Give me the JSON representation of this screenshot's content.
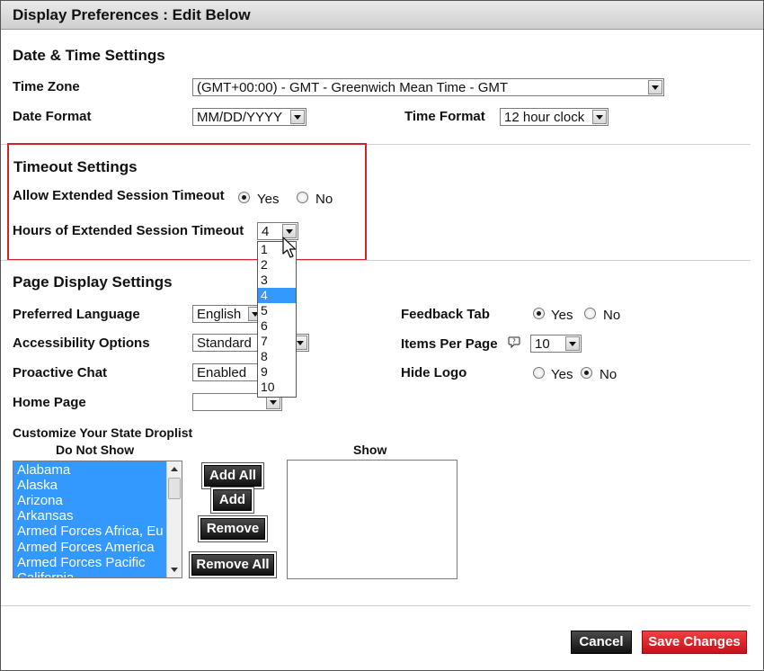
{
  "window": {
    "title": "Display Preferences : Edit Below"
  },
  "datetime": {
    "section_title": "Date & Time Settings",
    "timezone_label": "Time Zone",
    "timezone_value": "(GMT+00:00) - GMT - Greenwich Mean Time - GMT",
    "date_format_label": "Date Format",
    "date_format_value": "MM/DD/YYYY",
    "time_format_label": "Time Format",
    "time_format_value": "12 hour clock"
  },
  "timeout": {
    "section_title": "Timeout Settings",
    "allow_label": "Allow Extended Session Timeout",
    "yes": "Yes",
    "no": "No",
    "allow_selected": "Yes",
    "hours_label": "Hours of Extended Session Timeout",
    "hours_value": "4",
    "hours_options": [
      "1",
      "2",
      "3",
      "4",
      "5",
      "6",
      "7",
      "8",
      "9",
      "10"
    ],
    "highlight_color": "#d2232a"
  },
  "page_display": {
    "section_title": "Page Display Settings",
    "language_label": "Preferred Language",
    "language_value": "English",
    "accessibility_label": "Accessibility Options",
    "accessibility_value": "Standard",
    "proactive_label": "Proactive Chat",
    "proactive_value": "Enabled",
    "home_label": "Home Page",
    "home_value": "",
    "feedback_label": "Feedback Tab",
    "feedback_yes": "Yes",
    "feedback_no": "No",
    "feedback_selected": "Yes",
    "items_label": "Items Per Page",
    "items_value": "10",
    "hide_logo_label": "Hide Logo",
    "hide_yes": "Yes",
    "hide_no": "No",
    "hide_selected": "No"
  },
  "droplist": {
    "title": "Customize Your State Droplist",
    "do_not_show_label": "Do Not Show",
    "show_label": "Show",
    "states": [
      "Alabama",
      "Alaska",
      "Arizona",
      "Arkansas",
      "Armed Forces Africa, Eu",
      "Armed Forces America",
      "Armed Forces Pacific",
      "California"
    ],
    "add_all": "Add All",
    "add": "Add",
    "remove": "Remove",
    "remove_all": "Remove All",
    "selection_color": "#3399ff"
  },
  "footer": {
    "cancel": "Cancel",
    "save": "Save Changes",
    "save_color": "#d7141d"
  }
}
